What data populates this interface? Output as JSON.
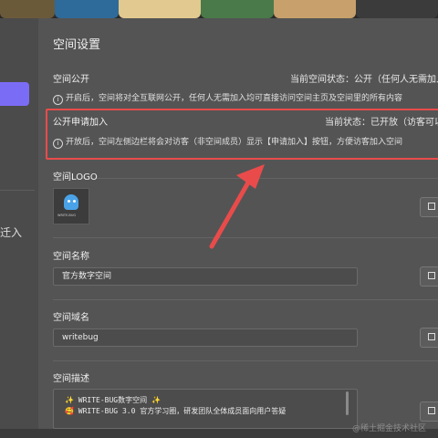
{
  "page_title": "空间设置",
  "left_panel": {
    "partial_item_label": "迁入"
  },
  "sections": {
    "public": {
      "title": "空间公开",
      "status": "当前空间状态：公开（任何人无需加入可",
      "desc": "开启后，空间将对全互联网公开，任何人无需加入均可直接访问空间主页及空间里的所有内容"
    },
    "apply": {
      "title": "公开申请加入",
      "status": "当前状态：已开放（访客可以主",
      "desc": "开放后，空间左侧边栏将会对访客（非空间成员）显示【申请加入】按钮，方便访客加入空间"
    },
    "logo": {
      "title": "空间LOGO",
      "image_caption": "WRITE-BUG"
    },
    "name": {
      "title": "空间名称",
      "value": "官方数字空间"
    },
    "domain": {
      "title": "空间域名",
      "value": "writebug"
    },
    "desc": {
      "title": "空间描述",
      "lines": [
        "✨ WRITE-BUG数字空间 ✨",
        "🥰 WRITE-BUG 3.0 官方学习圈，研发团队全体成员面向用户答疑"
      ]
    }
  },
  "edit_button_label": "修",
  "info_icon": "info-circle-icon",
  "watermark": "@稀土掘金技术社区",
  "colors": {
    "accent": "#7b6cf6",
    "highlight_border": "#e94b4b",
    "arrow": "#e94b4b"
  }
}
